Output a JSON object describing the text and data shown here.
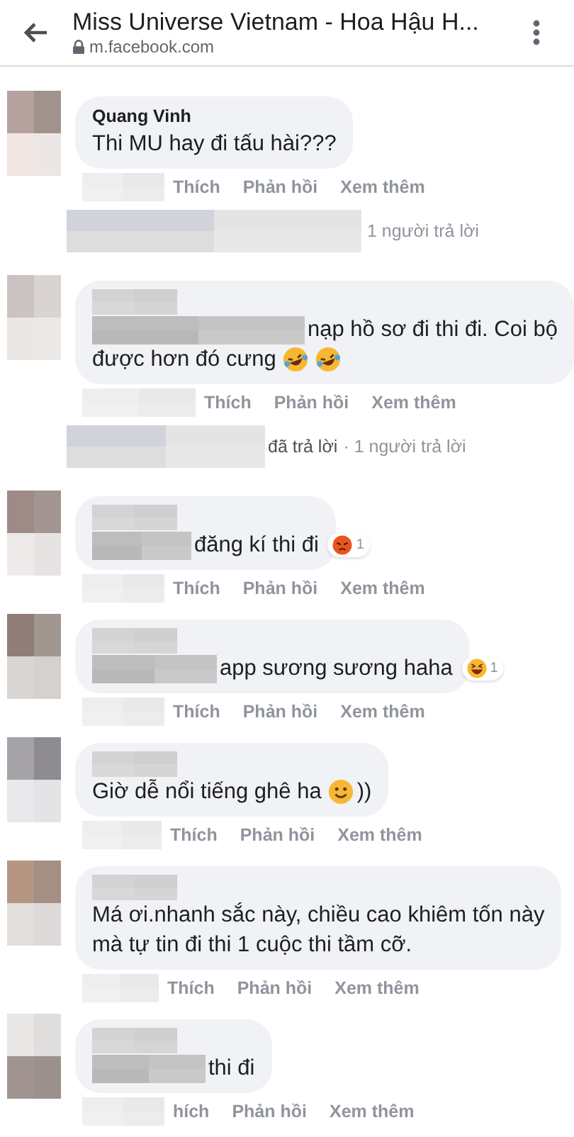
{
  "header": {
    "title": "Miss Universe Vietnam - Hoa Hậu H...",
    "url": "m.facebook.com"
  },
  "comments": [
    {
      "name": "Quang Vinh",
      "lines": [
        {
          "text": "Thi MU hay đi tấu hài???"
        }
      ],
      "actions": [
        "Thích",
        "Phản hồi",
        "Xem thêm"
      ],
      "replies": {
        "count": "1 người trả lời"
      }
    },
    {
      "lines": [
        {
          "text": "nạp hồ sơ đi thi đi. Coi bộ"
        },
        {
          "text": "được hơn đó cưng",
          "emojis": [
            {
              "kind": "rofl"
            },
            {
              "kind": "rofl"
            }
          ]
        }
      ],
      "actions": [
        "Thích",
        "Phản hồi",
        "Xem thêm"
      ],
      "replies": {
        "replied": "đã trả lời",
        "count": "· 1 người trả lời"
      }
    },
    {
      "lines": [
        {
          "text": "đăng kí thi đi"
        }
      ],
      "reaction": {
        "kind": "angry",
        "count": "1"
      },
      "actions": [
        "Thích",
        "Phản hồi",
        "Xem thêm"
      ]
    },
    {
      "lines": [
        {
          "text": "app sương sương haha"
        }
      ],
      "reaction": {
        "kind": "laugh",
        "count": "1"
      },
      "actions": [
        "Thích",
        "Phản hồi",
        "Xem thêm"
      ]
    },
    {
      "lines": [
        {
          "text": "Giờ dễ nổi tiếng ghê ha",
          "emojis": [
            {
              "kind": "smile"
            }
          ],
          "after": "))"
        }
      ],
      "actions": [
        "Thích",
        "Phản hồi",
        "Xem thêm"
      ]
    },
    {
      "lines": [
        {
          "text": "Má ơi.nhanh sắc này, chiều cao khiêm tốn này"
        },
        {
          "text": "mà tự tin đi thi 1 cuộc thi tầm cỡ."
        }
      ],
      "actions": [
        "Thích",
        "Phản hồi",
        "Xem thêm"
      ]
    },
    {
      "lines": [
        {
          "text": "thi đi"
        }
      ],
      "actions": [
        "hích",
        "Phản hồi",
        "Xem thêm"
      ]
    }
  ]
}
